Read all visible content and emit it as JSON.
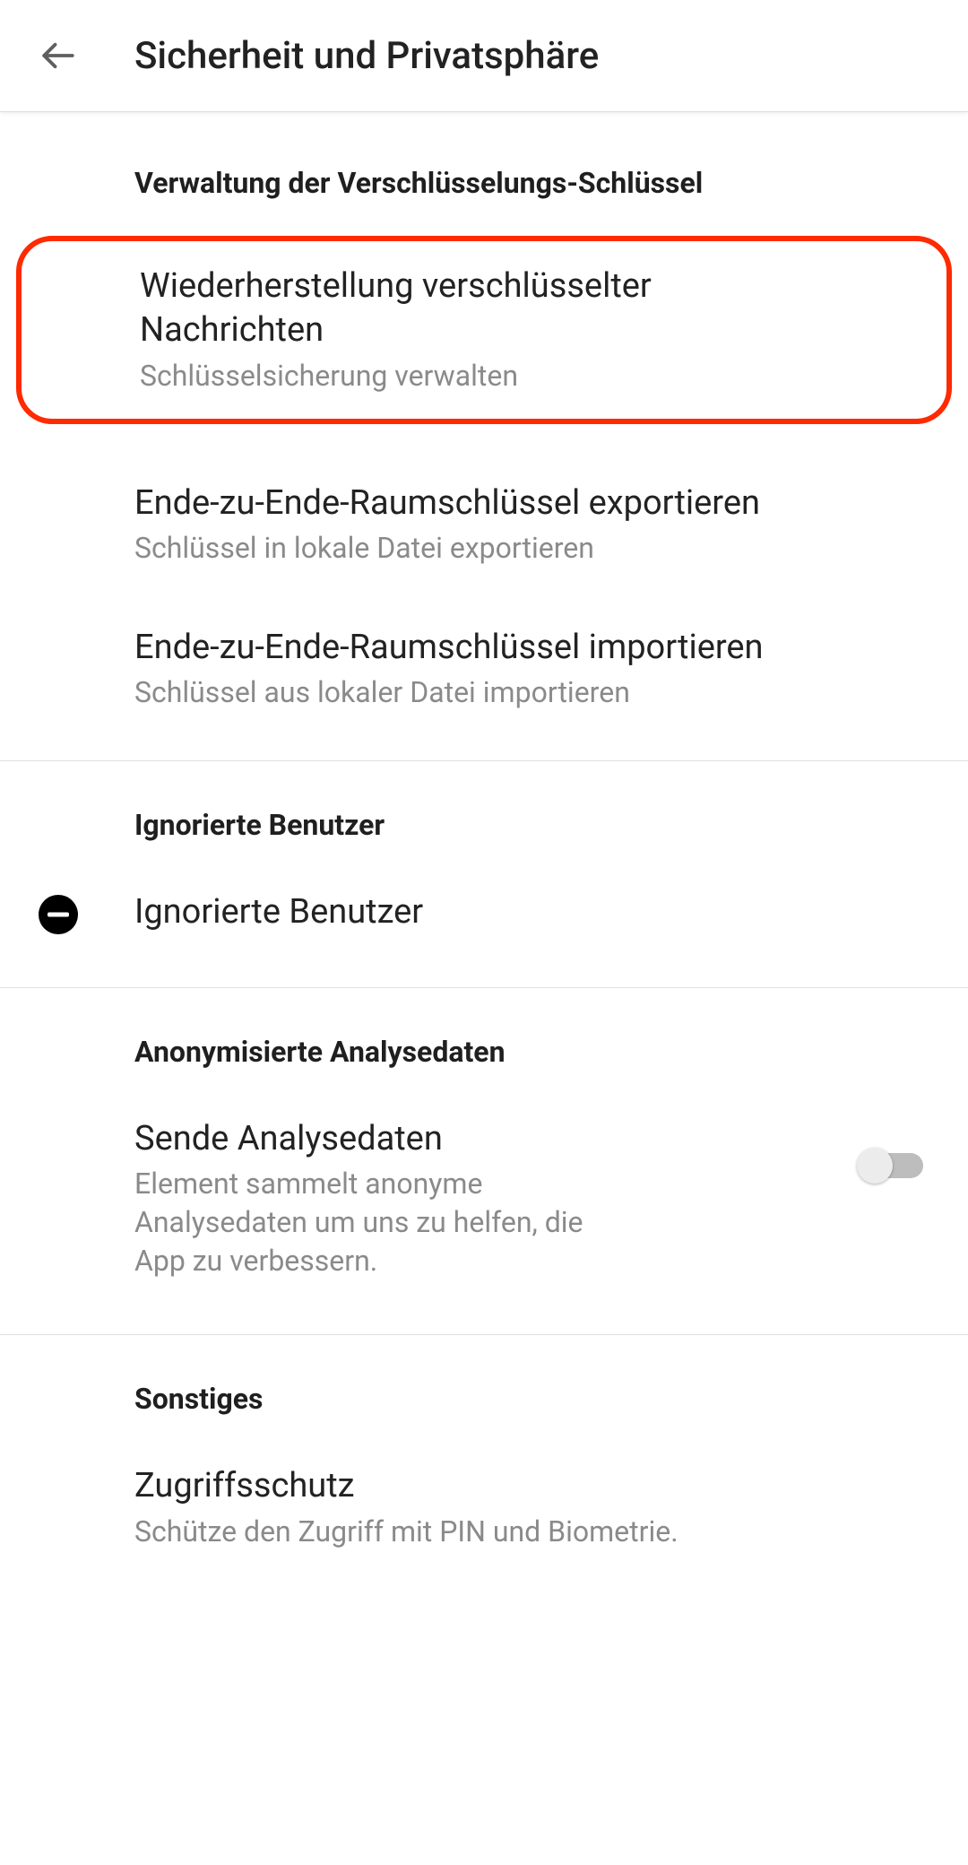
{
  "header": {
    "title": "Sicherheit und Privatsphäre"
  },
  "sections": {
    "keys": {
      "header": "Verwaltung der Verschlüsselungs-Schlüssel",
      "recovery": {
        "title": "Wiederherstellung verschlüsselter Nachrichten",
        "sub": "Schlüsselsicherung verwalten"
      },
      "export": {
        "title": "Ende-zu-Ende-Raumschlüssel exportieren",
        "sub": "Schlüssel in lokale Datei exportieren"
      },
      "import": {
        "title": "Ende-zu-Ende-Raumschlüssel importieren",
        "sub": "Schlüssel aus lokaler Datei importieren"
      }
    },
    "ignored": {
      "header": "Ignorierte Benutzer",
      "item": {
        "title": "Ignorierte Benutzer"
      }
    },
    "analytics": {
      "header": "Anonymisierte Analysedaten",
      "send": {
        "title": "Sende Analysedaten",
        "sub": "Element sammelt anonyme Analysedaten um uns zu helfen, die App zu verbessern.",
        "on": false
      }
    },
    "other": {
      "header": "Sonstiges",
      "access": {
        "title": "Zugriffsschutz",
        "sub": "Schütze den Zugriff mit PIN und Biometrie."
      }
    }
  }
}
